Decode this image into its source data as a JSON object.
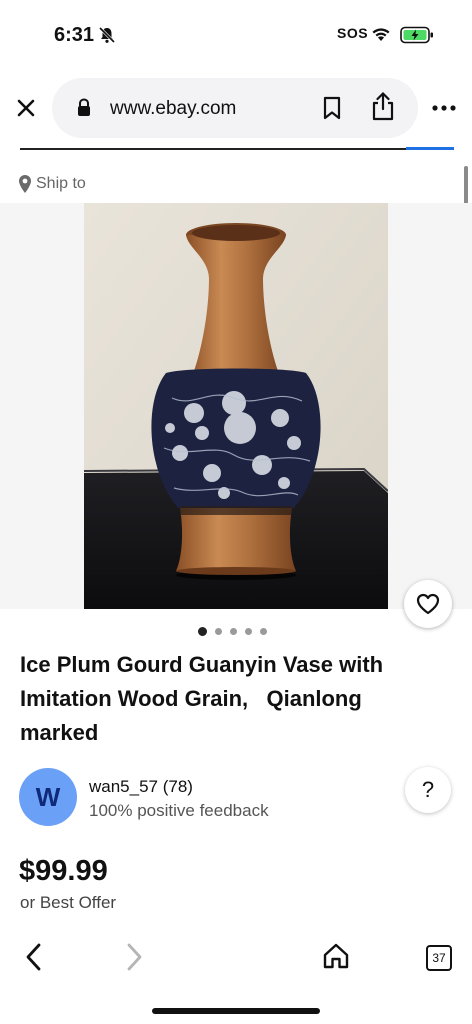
{
  "status_bar": {
    "time": "6:31",
    "sos": "SOS"
  },
  "browser": {
    "url": "www.ebay.com"
  },
  "listing": {
    "ship_to": "Ship to",
    "title": "Ice Plum Gourd Guanyin Vase with\nImitation Wood Grain,   Qianlong\nmarked",
    "photo_count": 5,
    "active_photo": 1,
    "seller": {
      "initial": "W",
      "name": "wan5_57 (78)",
      "feedback": "100% positive feedback"
    },
    "price": "$99.99",
    "offer_note": "or Best Offer",
    "help": "?"
  },
  "bottom_nav": {
    "tab_count": "37"
  },
  "colors": {
    "accent_blue": "#1f6fe5",
    "avatar": "#6ba0f7",
    "battery": "#4cd964"
  }
}
